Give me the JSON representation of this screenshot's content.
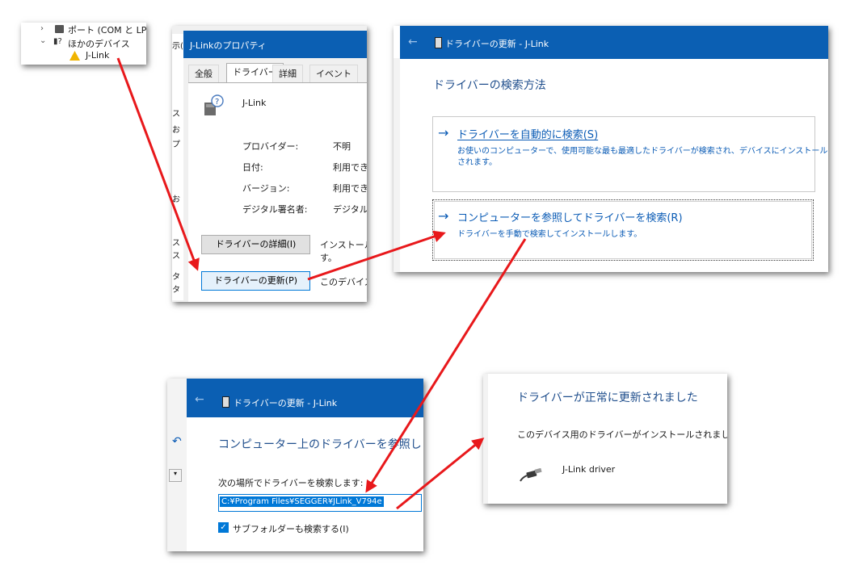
{
  "device_tree": {
    "ports_label": "ポート (COM と LPT",
    "other_label": "ほかのデバイス",
    "jlink_label": "J-Link"
  },
  "properties": {
    "title": "J-Linkのプロパティ",
    "tabs": [
      "全般",
      "ドライバー",
      "詳細",
      "イベント"
    ],
    "device_name": "J-Link",
    "rows": [
      {
        "label": "プロバイダー:",
        "value": "不明"
      },
      {
        "label": "日付:",
        "value": "利用でき"
      },
      {
        "label": "バージョン:",
        "value": "利用でき"
      },
      {
        "label": "デジタル署名者:",
        "value": "デジタル"
      }
    ],
    "details_button": "ドライバーの詳細(I)",
    "details_desc": "インストールさ",
    "details_desc2": "す。",
    "update_button": "ドライバーの更新(P)",
    "update_desc": "このデバイスの",
    "side_fragments": [
      "示(",
      "ス",
      "お",
      "プ",
      "お",
      "ス",
      "ス",
      "タ",
      "タ"
    ]
  },
  "update_dialog": {
    "title": "ドライバーの更新 - J-Link",
    "heading": "ドライバーの検索方法",
    "option_auto_title": "ドライバーを自動的に検索(S)",
    "option_auto_desc1": "お使いのコンピューターで、使用可能な最も最適したドライバーが検索され、デバイスにインストール",
    "option_auto_desc2": "されます。",
    "option_browse_title": "コンピューターを参照してドライバーを検索(R)",
    "option_browse_desc": "ドライバーを手動で検索してインストールします。"
  },
  "browse_dialog": {
    "title": "ドライバーの更新 - J-Link",
    "heading": "コンピューター上のドライバーを参照します。",
    "search_label": "次の場所でドライバーを検索します:",
    "path_value": "C:¥Program Files¥SEGGER¥JLink_V794e",
    "subfolder_label": "サブフォルダーも検索する(I)"
  },
  "success_dialog": {
    "heading": "ドライバーが正常に更新されました",
    "message": "このデバイス用のドライバーがインストールされました:",
    "driver_name": "J-Link driver"
  },
  "colors": {
    "titlebar_blue": "#0b5fb3",
    "link_blue": "#0a5bb5",
    "arrow_red": "#e8181b"
  },
  "icons": [
    "chevron-right-icon",
    "chevron-down-icon",
    "port-icon",
    "unknown-device-icon",
    "warning-device-icon",
    "back-arrow-icon",
    "arrow-right-icon",
    "checkbox-checked-icon",
    "usb-cable-icon"
  ]
}
